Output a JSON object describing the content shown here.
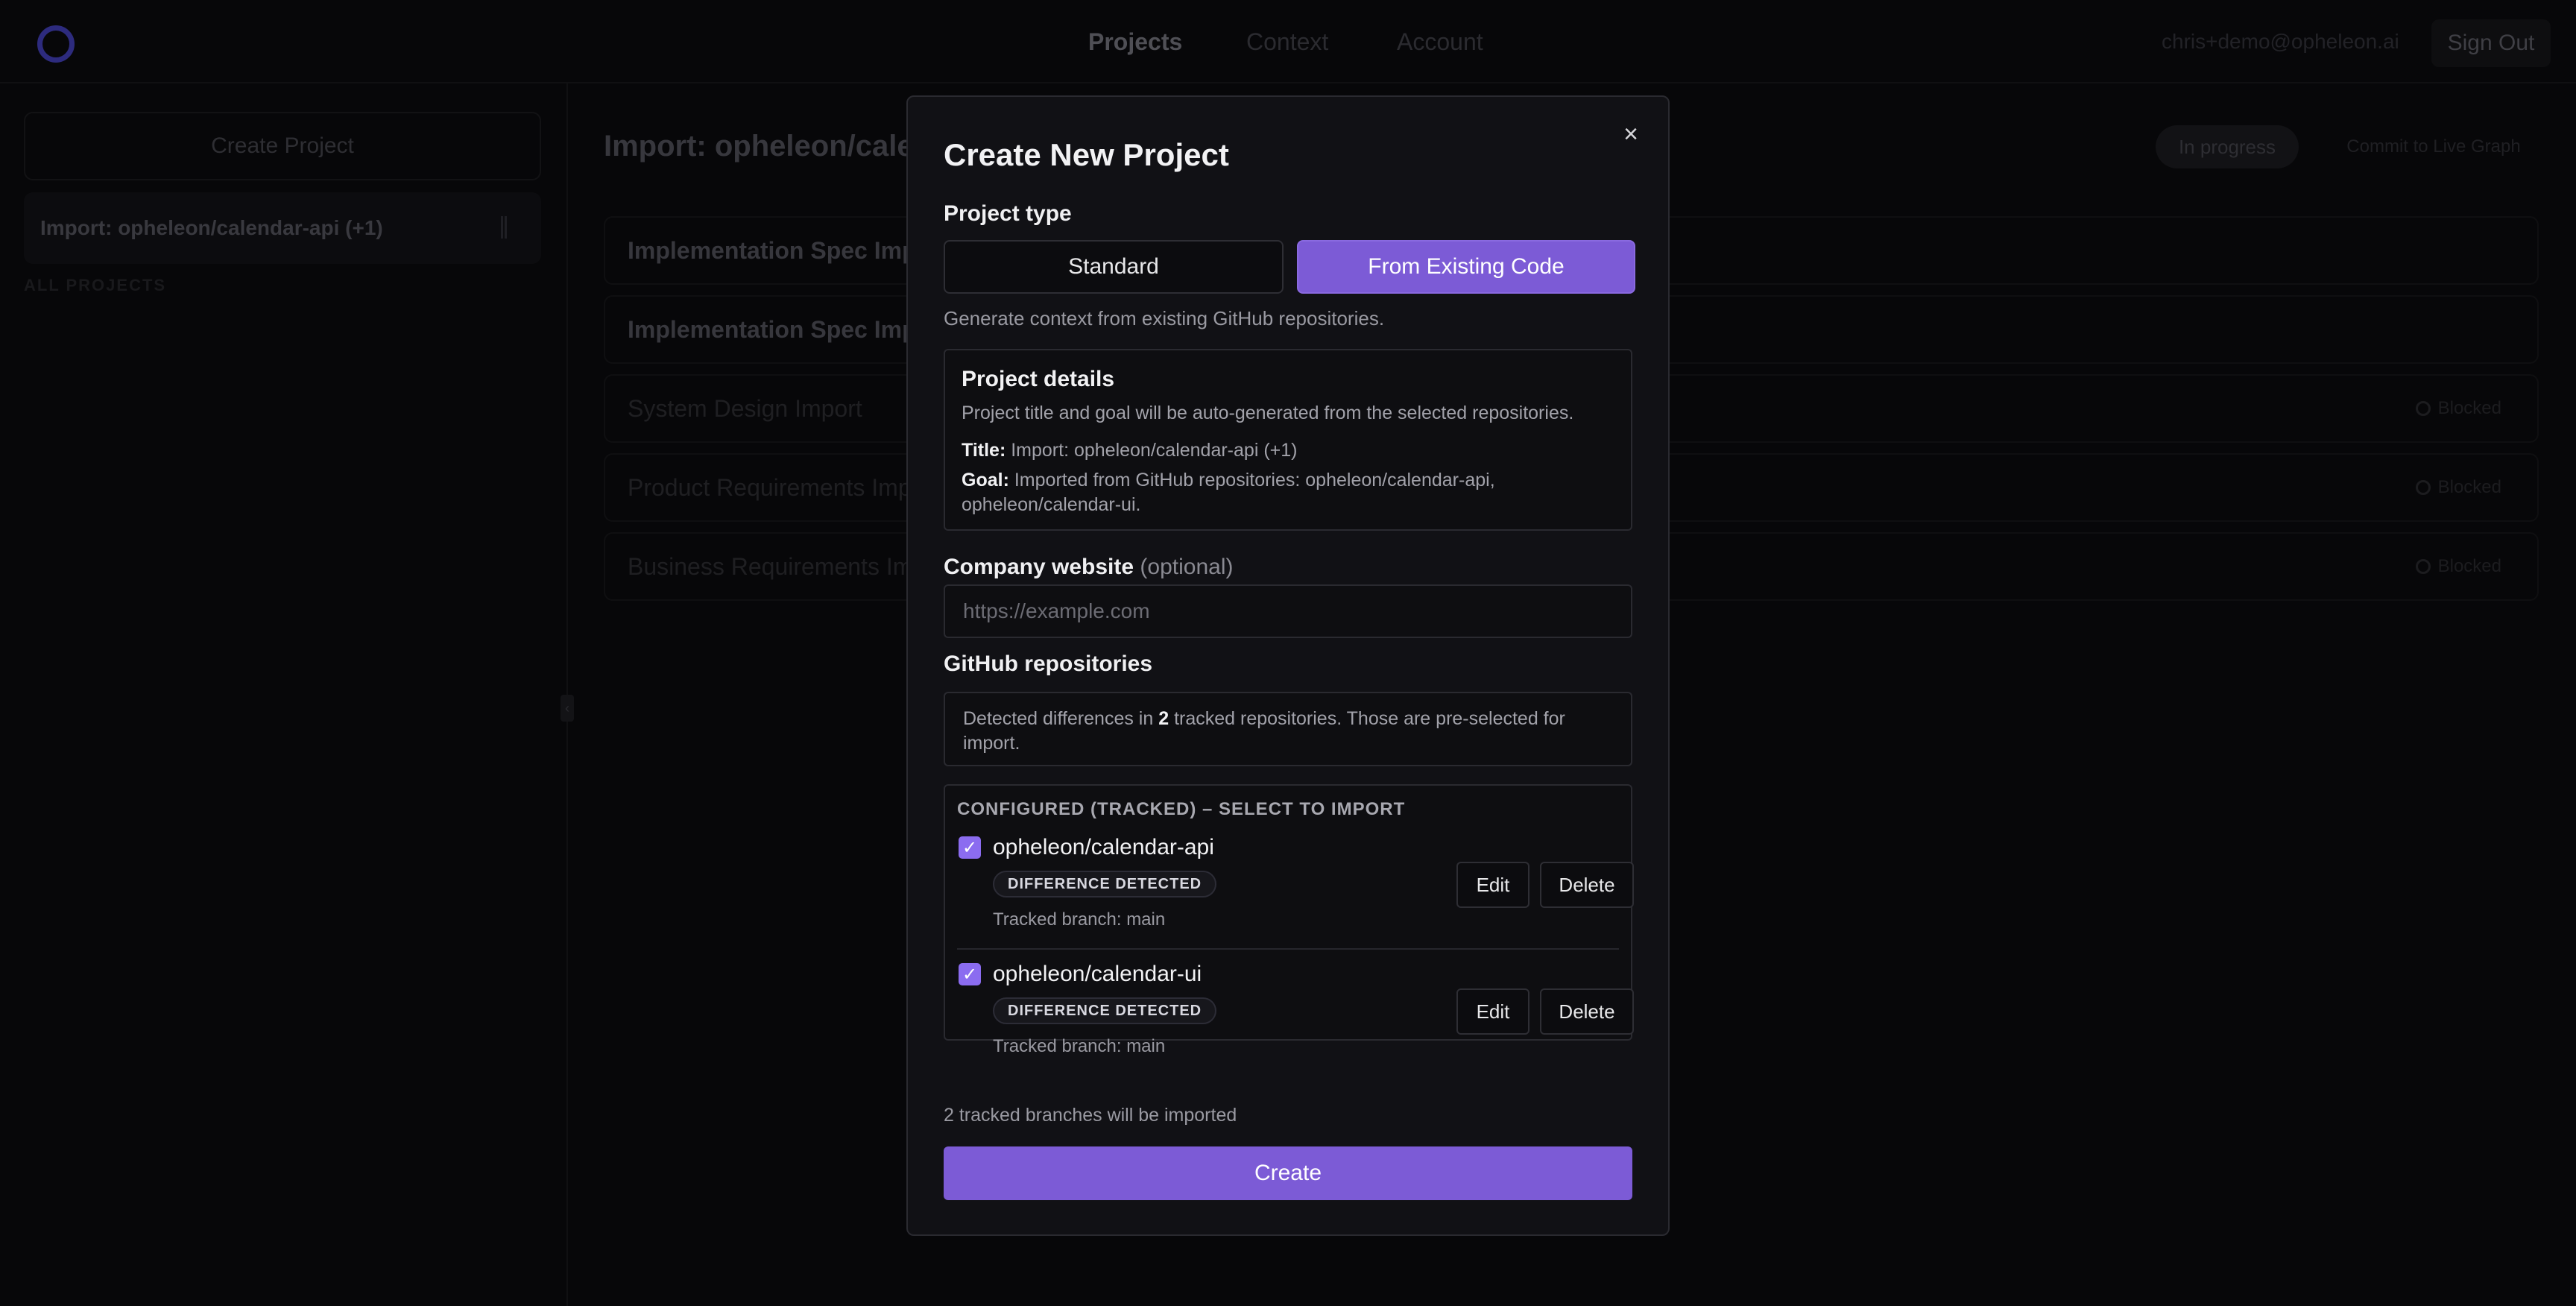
{
  "nav": {
    "items": [
      {
        "label": "Projects",
        "active": true
      },
      {
        "label": "Context",
        "active": false
      },
      {
        "label": "Account",
        "active": false
      }
    ],
    "user_email": "chris+demo@opheleon.ai",
    "sign_out_label": "Sign Out"
  },
  "sidebar": {
    "create_label": "Create Project",
    "items": [
      {
        "label": "Import: opheleon/calendar-api (+1)"
      }
    ],
    "section_label": "ALL PROJECTS"
  },
  "main": {
    "title": "Import: opheleon/calendar-api (+1)",
    "status": "In progress",
    "commit_label": "Commit to Live Graph",
    "docs": [
      {
        "title": "Implementation Spec Import",
        "status": ""
      },
      {
        "title": "Implementation Spec Import",
        "status": ""
      },
      {
        "title": "System Design Import",
        "status": "Blocked"
      },
      {
        "title": "Product Requirements Import",
        "status": "Blocked"
      },
      {
        "title": "Business Requirements Import",
        "status": "Blocked"
      }
    ]
  },
  "modal": {
    "title": "Create New Project",
    "close_icon": "×",
    "project_type_label": "Project type",
    "type_options": {
      "standard": "Standard",
      "existing": "From Existing Code"
    },
    "selected_type": "From Existing Code",
    "type_helper": "Generate context from existing GitHub repositories.",
    "details": {
      "title": "Project details",
      "description": "Project title and goal will be auto-generated from the selected repositories.",
      "title_key": "Title:",
      "title_value": "Import: opheleon/calendar-api (+1)",
      "goal_key": "Goal:",
      "goal_value": "Imported from GitHub repositories: opheleon/calendar-api, opheleon/calendar-ui."
    },
    "website": {
      "label": "Company website",
      "optional": "(optional)",
      "value": "",
      "placeholder": "https://example.com"
    },
    "github": {
      "label": "GitHub repositories",
      "detected_prefix": "Detected differences in",
      "detected_count": "2",
      "detected_suffix": "tracked repositories. Those are pre-selected for import.",
      "section_header": "CONFIGURED (TRACKED) – SELECT TO IMPORT",
      "repos": [
        {
          "name": "opheleon/calendar-api",
          "checked": true,
          "badge": "DIFFERENCE DETECTED",
          "branch": "Tracked branch: main",
          "edit": "Edit",
          "delete": "Delete"
        },
        {
          "name": "opheleon/calendar-ui",
          "checked": true,
          "badge": "DIFFERENCE DETECTED",
          "branch": "Tracked branch: main",
          "edit": "Edit",
          "delete": "Delete"
        }
      ]
    },
    "footer_note": "2 tracked branches will be imported",
    "create_label": "Create"
  },
  "colors": {
    "accent": "#7c5bd6",
    "checkbox": "#8b6cf0",
    "background": "#0a0a0c",
    "modal": "#111115"
  },
  "icons": {
    "close": "close-icon",
    "check": "check-icon",
    "logo": "logo-ring-icon",
    "more": "more-vertical-icon",
    "blocked": "circle-icon",
    "collapse": "chevron-left-icon"
  }
}
